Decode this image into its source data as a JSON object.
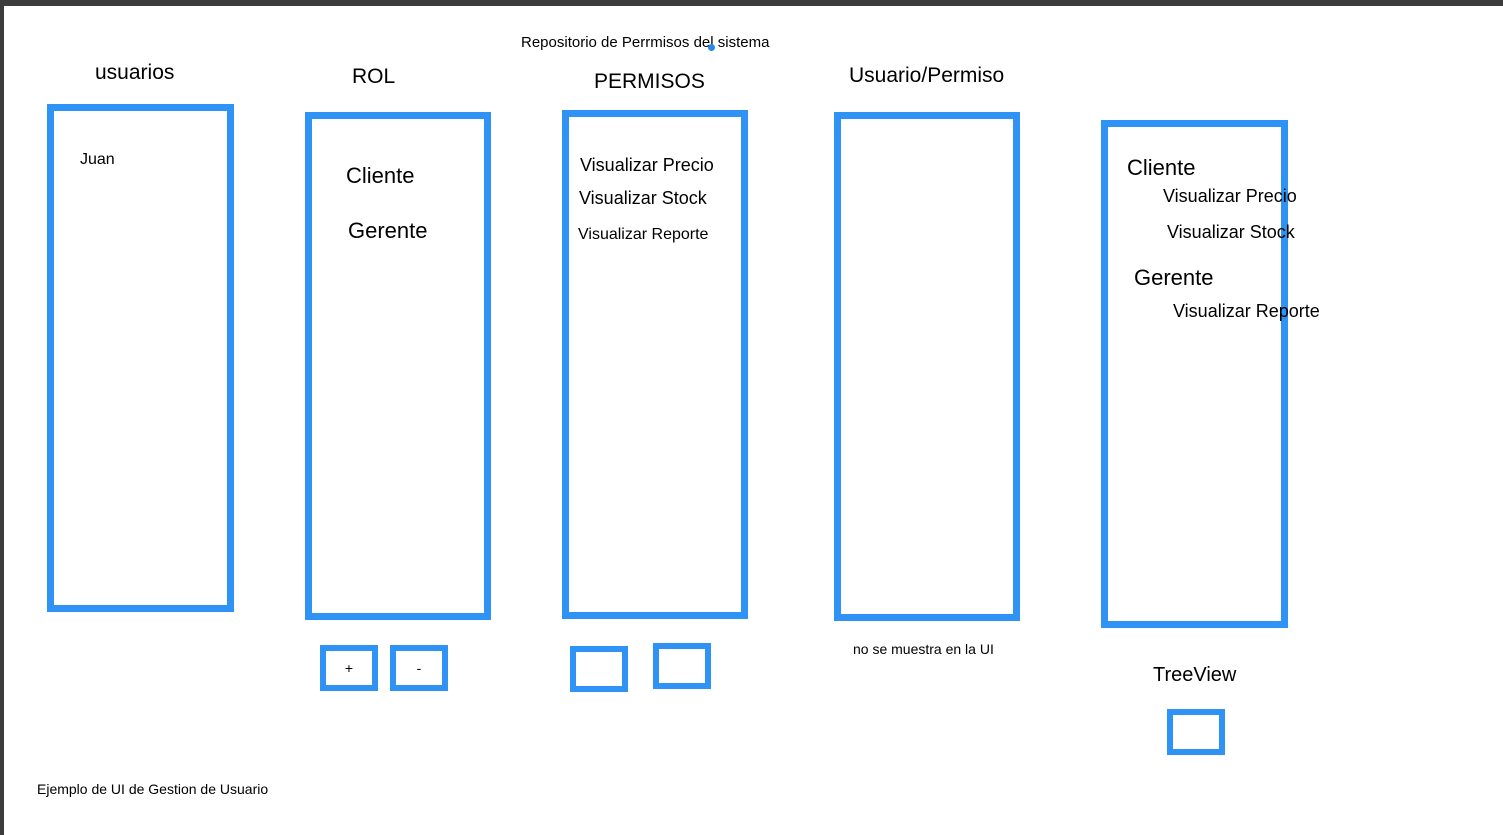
{
  "header": {
    "title": "Repositorio de Perrmisos del sistema"
  },
  "columns": {
    "usuarios": {
      "title": "usuarios",
      "items": [
        "Juan"
      ]
    },
    "rol": {
      "title": "ROL",
      "items": [
        "Cliente",
        "Gerente"
      ],
      "add_label": "+",
      "remove_label": "-"
    },
    "permisos": {
      "title": "PERMISOS",
      "items": [
        "Visualizar Precio",
        "Visualizar Stock",
        "Visualizar Reporte"
      ]
    },
    "usuario_permiso": {
      "title": "Usuario/Permiso",
      "note": "no se muestra en la UI"
    },
    "treeview": {
      "label": "TreeView",
      "nodes": [
        {
          "label": "Cliente",
          "children": [
            "Visualizar Precio",
            "Visualizar Stock"
          ]
        },
        {
          "label": "Gerente",
          "children": [
            "Visualizar Reporte"
          ]
        }
      ]
    }
  },
  "footer": {
    "caption": "Ejemplo de UI de Gestion de Usuario"
  },
  "colors": {
    "accent": "#2e93f5",
    "frame": "#3c3c3c"
  }
}
